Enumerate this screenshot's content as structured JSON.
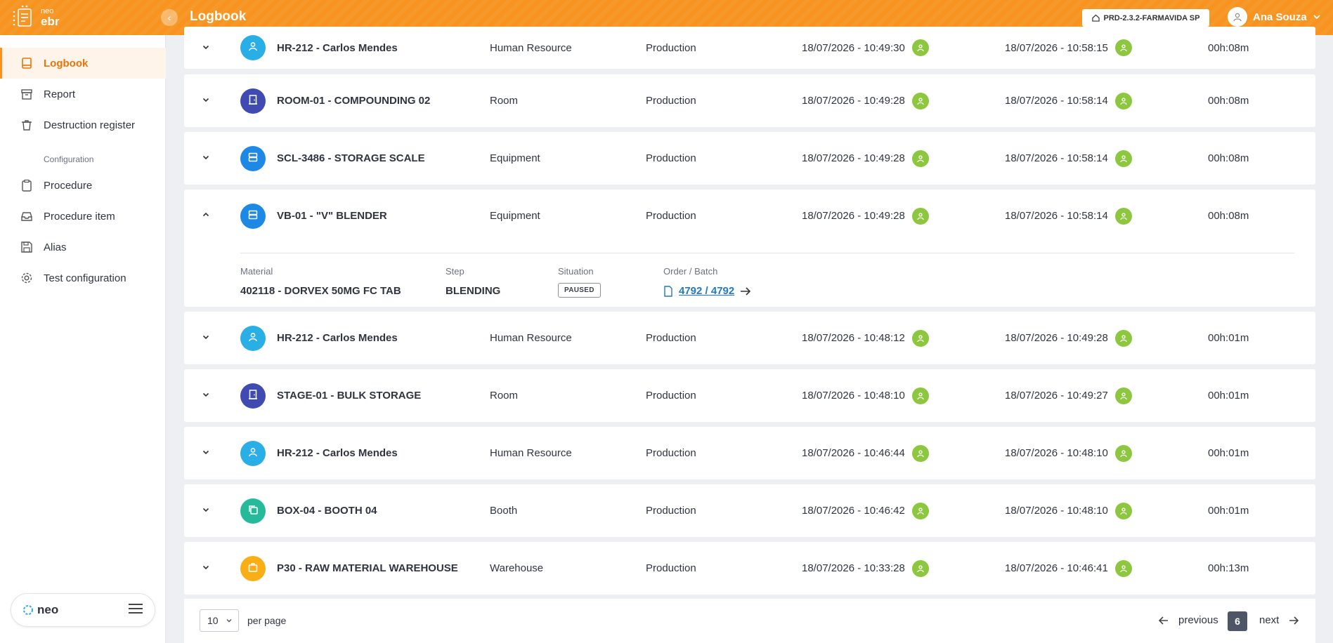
{
  "header": {
    "logo_small": "neo",
    "logo_big": "ebr",
    "title": "Logbook",
    "environment": "PRD-2.3.2-FARMAVIDA SP",
    "user_name": "Ana Souza",
    "accent_color": "#f7931e"
  },
  "sidebar": {
    "items": [
      {
        "label": "Logbook",
        "icon": "book-icon"
      },
      {
        "label": "Report",
        "icon": "archive-icon"
      },
      {
        "label": "Destruction register",
        "icon": "trash-icon"
      },
      {
        "label": "Procedure",
        "icon": "clipboard-icon"
      },
      {
        "label": "Procedure item",
        "icon": "inbox-icon"
      },
      {
        "label": "Alias",
        "icon": "save-icon"
      },
      {
        "label": "Test configuration",
        "icon": "gear-icon"
      }
    ],
    "section_label": "Configuration",
    "footer_logo": "neo"
  },
  "rows": [
    {
      "name": "HR-212 - Carlos Mendes",
      "type": "Human Resource",
      "area": "Production",
      "start": "18/07/2026 - 10:49:30",
      "end": "18/07/2026 - 10:58:15",
      "duration": "00h:08m",
      "icon": "person-icon",
      "color": "#29aee6"
    },
    {
      "name": "ROOM-01 - COMPOUNDING 02",
      "type": "Room",
      "area": "Production",
      "start": "18/07/2026 - 10:49:28",
      "end": "18/07/2026 - 10:58:14",
      "duration": "00h:08m",
      "icon": "door-icon",
      "color": "#3f4bb0"
    },
    {
      "name": "SCL-3486 - STORAGE SCALE",
      "type": "Equipment",
      "area": "Production",
      "start": "18/07/2026 - 10:49:28",
      "end": "18/07/2026 - 10:58:14",
      "duration": "00h:08m",
      "icon": "server-icon",
      "color": "#1e88e5"
    },
    {
      "name": "VB-01 - \"V\" BLENDER",
      "type": "Equipment",
      "area": "Production",
      "start": "18/07/2026 - 10:49:28",
      "end": "18/07/2026 - 10:58:14",
      "duration": "00h:08m",
      "icon": "server-icon",
      "color": "#1e88e5",
      "expanded": true
    },
    {
      "name": "HR-212 - Carlos Mendes",
      "type": "Human Resource",
      "area": "Production",
      "start": "18/07/2026 - 10:48:12",
      "end": "18/07/2026 - 10:49:28",
      "duration": "00h:01m",
      "icon": "person-icon",
      "color": "#29aee6"
    },
    {
      "name": "STAGE-01 - BULK STORAGE",
      "type": "Room",
      "area": "Production",
      "start": "18/07/2026 - 10:48:10",
      "end": "18/07/2026 - 10:49:27",
      "duration": "00h:01m",
      "icon": "door-icon",
      "color": "#3f4bb0"
    },
    {
      "name": "HR-212 - Carlos Mendes",
      "type": "Human Resource",
      "area": "Production",
      "start": "18/07/2026 - 10:46:44",
      "end": "18/07/2026 - 10:48:10",
      "duration": "00h:01m",
      "icon": "person-icon",
      "color": "#29aee6"
    },
    {
      "name": "BOX-04 - BOOTH 04",
      "type": "Booth",
      "area": "Production",
      "start": "18/07/2026 - 10:46:42",
      "end": "18/07/2026 - 10:48:10",
      "duration": "00h:01m",
      "icon": "copy-icon",
      "color": "#26b99a"
    },
    {
      "name": "P30 - RAW MATERIAL WAREHOUSE",
      "type": "Warehouse",
      "area": "Production",
      "start": "18/07/2026 - 10:33:28",
      "end": "18/07/2026 - 10:46:41",
      "duration": "00h:13m",
      "icon": "box-icon",
      "color": "#f9ae16"
    }
  ],
  "details": {
    "material_label": "Material",
    "material_value": "402118 - DORVEX 50MG FC TAB",
    "step_label": "Step",
    "step_value": "BLENDING",
    "situation_label": "Situation",
    "situation_value": "PAUSED",
    "order_label": "Order / Batch",
    "order_value": "4792 / 4792"
  },
  "pagination": {
    "per_page_value": "10",
    "per_page_label": "per page",
    "previous": "previous",
    "current_page": "6",
    "next": "next"
  }
}
